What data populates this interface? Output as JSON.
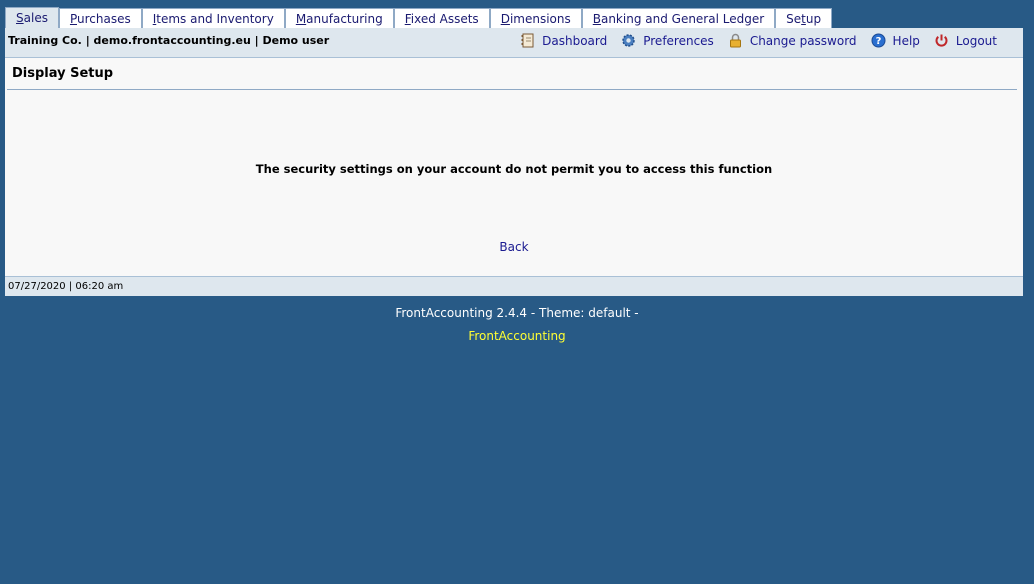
{
  "tabs": [
    {
      "pre": "",
      "key": "S",
      "rest": "ales",
      "active": true
    },
    {
      "pre": "",
      "key": "P",
      "rest": "urchases"
    },
    {
      "pre": "",
      "key": "I",
      "rest": "tems and Inventory"
    },
    {
      "pre": "",
      "key": "M",
      "rest": "anufacturing"
    },
    {
      "pre": "",
      "key": "F",
      "rest": "ixed Assets"
    },
    {
      "pre": "",
      "key": "D",
      "rest": "imensions"
    },
    {
      "pre": "",
      "key": "B",
      "rest": "anking and General Ledger"
    },
    {
      "pre": "Se",
      "key": "t",
      "rest": "up"
    }
  ],
  "header": {
    "company_info": "Training Co. | demo.frontaccounting.eu | Demo user",
    "links": {
      "dashboard": "Dashboard",
      "preferences": "Preferences",
      "change_password": "Change password",
      "help": "Help",
      "logout": "Logout"
    }
  },
  "page": {
    "title": "Display Setup",
    "message": "The security settings on your account do not permit you to access this function",
    "back": "Back"
  },
  "status": {
    "datetime": "07/27/2020 | 06:20 am"
  },
  "footer": {
    "version": "FrontAccounting 2.4.4 - Theme: default -",
    "link": "FrontAccounting"
  },
  "colors": {
    "background": "#285a86",
    "bar": "#dee7ee",
    "link": "#1a1a90",
    "footer_link": "#ffff33"
  }
}
